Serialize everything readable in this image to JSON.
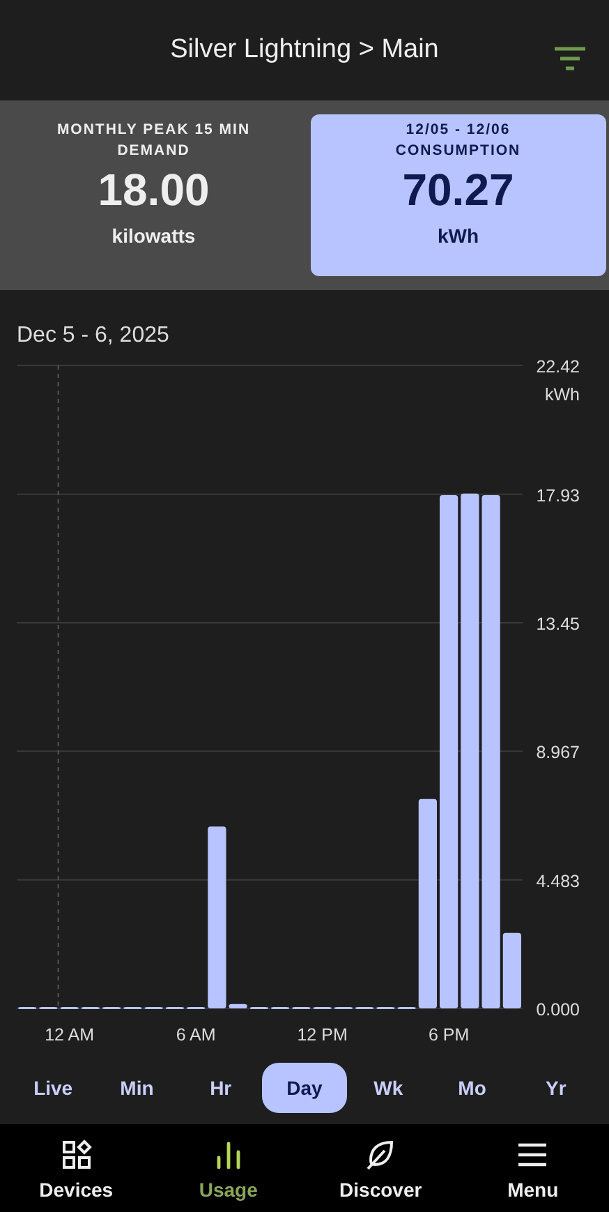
{
  "header": {
    "title": "Silver Lightning > Main"
  },
  "cards": [
    {
      "label": "MONTHLY PEAK 15 MIN DEMAND",
      "value": "18.00",
      "unit": "kilowatts",
      "selected": false
    },
    {
      "label": "12/05 - 12/06 CONSUMPTION",
      "value": "70.27",
      "unit": "kWh",
      "selected": true
    }
  ],
  "date_range": "Dec 5 - 6, 2025",
  "chart_data": {
    "type": "bar",
    "ylabel": "kWh",
    "ylim": [
      0,
      22.42
    ],
    "grid": true,
    "categories": [
      null,
      null,
      "12 AM",
      null,
      null,
      null,
      null,
      null,
      "6 AM",
      null,
      null,
      null,
      null,
      null,
      "12 PM",
      null,
      null,
      null,
      null,
      null,
      "6 PM",
      null,
      null,
      null
    ],
    "yticks": [
      {
        "value": 0,
        "label": "0.000"
      },
      {
        "value": 4.483,
        "label": "4.483"
      },
      {
        "value": 8.967,
        "label": "8.967"
      },
      {
        "value": 13.45,
        "label": "13.45"
      },
      {
        "value": 17.93,
        "label": "17.93"
      },
      {
        "value": 22.42,
        "label": "22.42"
      }
    ],
    "series": [
      {
        "color": "#b8c4ff",
        "values": [
          0.05,
          0.05,
          0.05,
          0.05,
          0.05,
          0.05,
          0.05,
          0.05,
          0.05,
          6.34,
          0.15,
          0.05,
          0.05,
          0.05,
          0.05,
          0.05,
          0.05,
          0.05,
          0.05,
          7.3,
          17.9,
          17.95,
          17.9,
          2.63
        ]
      }
    ]
  },
  "periods": [
    {
      "label": "Live",
      "selected": false
    },
    {
      "label": "Min",
      "selected": false
    },
    {
      "label": "Hr",
      "selected": false
    },
    {
      "label": "Day",
      "selected": true
    },
    {
      "label": "Wk",
      "selected": false
    },
    {
      "label": "Mo",
      "selected": false
    },
    {
      "label": "Yr",
      "selected": false
    }
  ],
  "nav": [
    {
      "kind": "devices",
      "label": "Devices",
      "selected": false
    },
    {
      "kind": "usage",
      "label": "Usage",
      "selected": true
    },
    {
      "kind": "discover",
      "label": "Discover",
      "selected": false
    },
    {
      "kind": "menu",
      "label": "Menu",
      "selected": false
    }
  ]
}
